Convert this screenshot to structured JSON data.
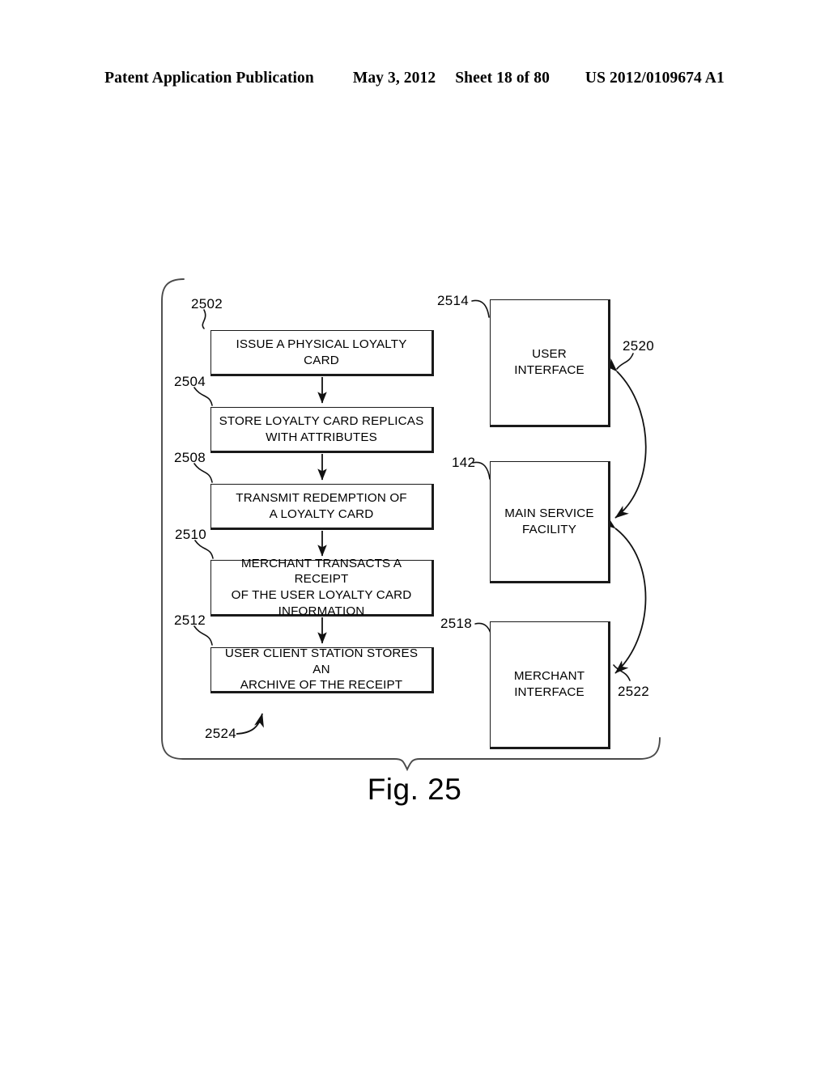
{
  "header": {
    "publication": "Patent Application Publication",
    "date": "May 3, 2012",
    "sheet": "Sheet 18 of 80",
    "number": "US 2012/0109674 A1"
  },
  "figure": {
    "caption": "Fig. 25",
    "overall_ref": "2524"
  },
  "flow_steps": [
    {
      "ref": "2502",
      "label": "ISSUE A PHYSICAL LOYALTY CARD"
    },
    {
      "ref": "2504",
      "label": "STORE LOYALTY CARD REPLICAS\nWITH ATTRIBUTES"
    },
    {
      "ref": "2508",
      "label": "TRANSMIT REDEMPTION OF\nA LOYALTY CARD"
    },
    {
      "ref": "2510",
      "label": "MERCHANT TRANSACTS A RECEIPT\nOF THE USER LOYALTY CARD\nINFORMATION"
    },
    {
      "ref": "2512",
      "label": "USER CLIENT STATION STORES AN\nARCHIVE OF THE RECEIPT"
    }
  ],
  "entities": [
    {
      "ref": "2514",
      "label": "USER INTERFACE"
    },
    {
      "ref": "142",
      "label": "MAIN SERVICE\nFACILITY"
    },
    {
      "ref": "2518",
      "label": "MERCHANT\nINTERFACE"
    }
  ],
  "connectors": [
    {
      "ref": "2520",
      "from": "USER INTERFACE",
      "to": "MAIN SERVICE FACILITY",
      "style": "double-headed-curve"
    },
    {
      "ref": "2522",
      "from": "MAIN SERVICE FACILITY",
      "to": "MERCHANT INTERFACE",
      "style": "double-headed-curve"
    }
  ],
  "colors": {
    "ink": "#000000",
    "paper": "#ffffff"
  }
}
